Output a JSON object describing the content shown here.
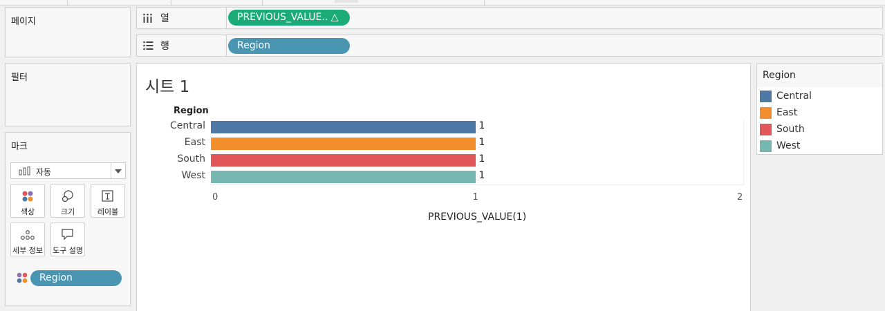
{
  "panels": {
    "pages_title": "페이지",
    "filters_title": "필터",
    "marks_title": "마크"
  },
  "columns_shelf": {
    "label": "열",
    "pill": "PREVIOUS_VALUE..  △"
  },
  "rows_shelf": {
    "label": "행",
    "pill": "Region"
  },
  "marks": {
    "mark_type": "자동",
    "buttons": {
      "color": "색상",
      "size": "크기",
      "label": "레이블",
      "detail": "세부 정보",
      "tooltip": "도구 설명"
    },
    "color_field": "Region"
  },
  "view": {
    "sheet_title": "시트 1",
    "row_header": "Region"
  },
  "chart_data": {
    "type": "bar",
    "orientation": "horizontal",
    "categories": [
      "Central",
      "East",
      "South",
      "West"
    ],
    "values": [
      1,
      1,
      1,
      1
    ],
    "data_labels": [
      "1",
      "1",
      "1",
      "1"
    ],
    "colors": [
      "#4e79a7",
      "#f28e2b",
      "#e15759",
      "#76b7b2"
    ],
    "xlabel": "PREVIOUS_VALUE(1)",
    "ylabel": "Region",
    "xlim": [
      0,
      2
    ],
    "ticks": [
      "0",
      "1",
      "2"
    ]
  },
  "legend": {
    "title": "Region",
    "items": [
      {
        "label": "Central",
        "color": "#4e79a7"
      },
      {
        "label": "East",
        "color": "#f28e2b"
      },
      {
        "label": "South",
        "color": "#e15759"
      },
      {
        "label": "West",
        "color": "#76b7b2"
      }
    ]
  }
}
